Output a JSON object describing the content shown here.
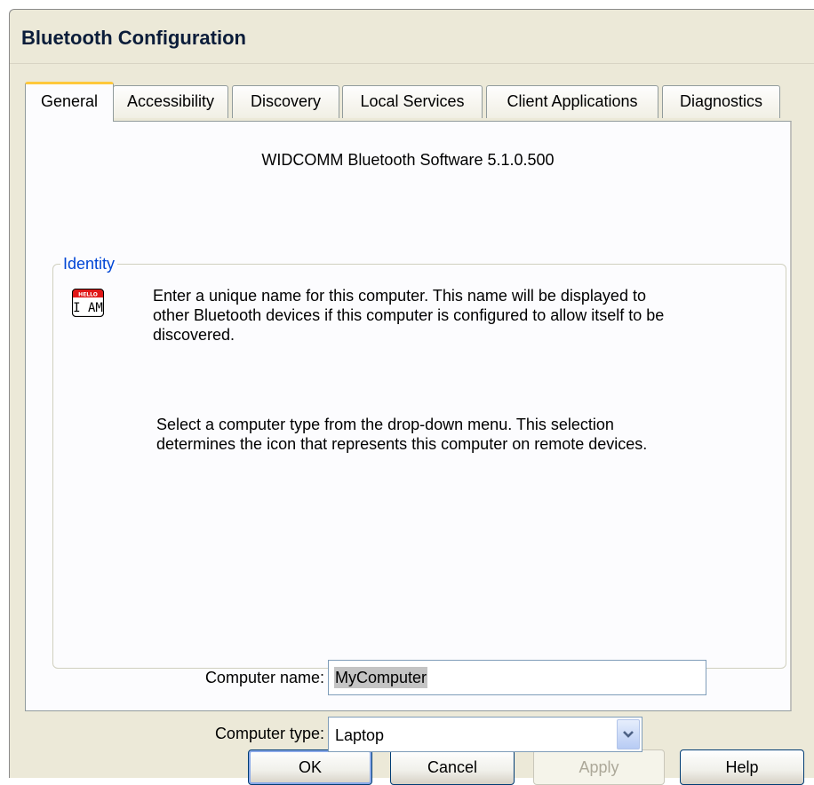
{
  "window": {
    "title": "Bluetooth Configuration"
  },
  "tabs": [
    {
      "label": "General",
      "active": true
    },
    {
      "label": "Accessibility"
    },
    {
      "label": "Discovery"
    },
    {
      "label": "Local Services"
    },
    {
      "label": "Client Applications"
    },
    {
      "label": "Diagnostics"
    }
  ],
  "general": {
    "software_version": "WIDCOMM Bluetooth Software 5.1.0.500",
    "identity": {
      "legend": "Identity",
      "icon": {
        "name": "iam-nametag-icon",
        "badge": "HELLO",
        "text": "I AM"
      },
      "description_lines": [
        "Enter a unique name for this computer.  This name will be displayed to",
        "other Bluetooth devices if this computer is configured to allow itself to be",
        "discovered."
      ],
      "type_help_lines": [
        "Select a computer type from the drop-down menu.  This selection",
        "determines the icon that represents this computer on remote devices."
      ],
      "computer_name_label": "Computer name:",
      "computer_name_value": "MyComputer",
      "computer_type_label": "Computer type:",
      "computer_type_value": "Laptop"
    }
  },
  "buttons": {
    "ok": "OK",
    "cancel": "Cancel",
    "apply": "Apply",
    "help": "Help"
  },
  "colors": {
    "dialog_bg": "#ece9d8",
    "panel_bg": "#fcfcfe",
    "tab_hot": "#ffc83c",
    "legend": "#0046d5",
    "button_border": "#003c74"
  }
}
